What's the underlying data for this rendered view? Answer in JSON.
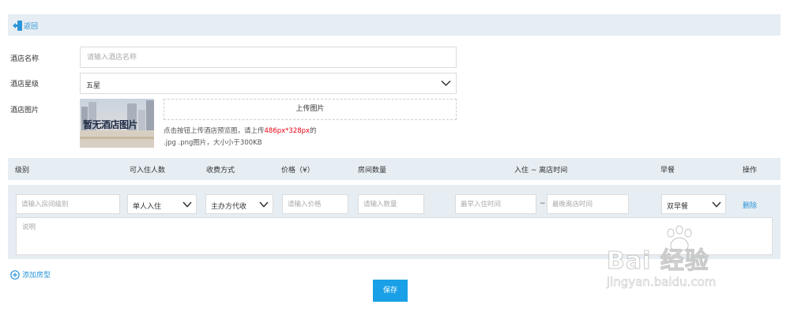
{
  "header": {
    "back_label": "返回"
  },
  "form": {
    "hotel_name_label": "酒店名称",
    "hotel_name_placeholder": "请输入酒店名称",
    "hotel_star_label": "酒店星级",
    "hotel_star_value": "五星",
    "hotel_image_label": "酒店图片",
    "image_placeholder_text": "暂无酒店图片",
    "upload_button": "上传图片",
    "upload_hint_prefix": "点击按钮上传酒店预览图，请上传",
    "upload_hint_size": "486px*328px",
    "upload_hint_suffix": "的",
    "upload_hint_line2": ".jpg .png图片，大小小于300KB"
  },
  "room_table": {
    "columns": [
      "级别",
      "可入住人数",
      "收费方式",
      "价格（¥）",
      "房间数量",
      "入住 ~ 离店时间",
      "早餐",
      "操作"
    ],
    "row": {
      "level_placeholder": "请输入房间级别",
      "occupancy_value": "单人入住",
      "charge_value": "主办方代收",
      "price_placeholder": "请输入价格",
      "quantity_placeholder": "请输入数量",
      "checkin_placeholder": "最早入住时间",
      "tilde": "~",
      "checkout_placeholder": "最晚离店时间",
      "breakfast_value": "双早餐",
      "delete_label": "删除",
      "description_placeholder": "说明"
    }
  },
  "actions": {
    "add_room_label": "添加房型",
    "save_label": "保存"
  },
  "watermark": {
    "main": "Bai 经验",
    "sub": "jingyan.baidu.com"
  },
  "colors": {
    "accent": "#1aa0e6",
    "link": "#2a94d8",
    "panel_bg": "#e6edf3",
    "hint_red": "#e60012"
  }
}
